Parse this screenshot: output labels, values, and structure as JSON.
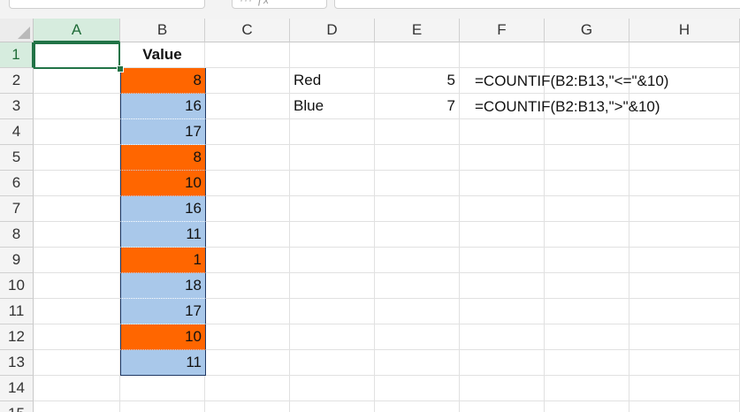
{
  "columns": [
    "A",
    "B",
    "C",
    "D",
    "E",
    "F",
    "G",
    "H"
  ],
  "rows": [
    "1",
    "2",
    "3",
    "4",
    "5",
    "6",
    "7",
    "8",
    "9",
    "10",
    "11",
    "12",
    "13",
    "14",
    "15"
  ],
  "selected_column": "A",
  "selected_row": "1",
  "header_B1": "Value",
  "values_B": [
    {
      "value": "8",
      "color": "red"
    },
    {
      "value": "16",
      "color": "blue"
    },
    {
      "value": "17",
      "color": "blue"
    },
    {
      "value": "8",
      "color": "red"
    },
    {
      "value": "10",
      "color": "red"
    },
    {
      "value": "16",
      "color": "blue"
    },
    {
      "value": "11",
      "color": "blue"
    },
    {
      "value": "1",
      "color": "red"
    },
    {
      "value": "18",
      "color": "blue"
    },
    {
      "value": "17",
      "color": "blue"
    },
    {
      "value": "10",
      "color": "red"
    },
    {
      "value": "11",
      "color": "blue"
    }
  ],
  "summary": [
    {
      "label": "Red",
      "count": "5",
      "formula": "=COUNTIF(B2:B13,\"<=\"&10)"
    },
    {
      "label": "Blue",
      "count": "7",
      "formula": "=COUNTIF(B2:B13,\">\"&10)"
    }
  ],
  "colors": {
    "red": "#ff6600",
    "blue": "#a9c8ea",
    "accent": "#217346"
  }
}
